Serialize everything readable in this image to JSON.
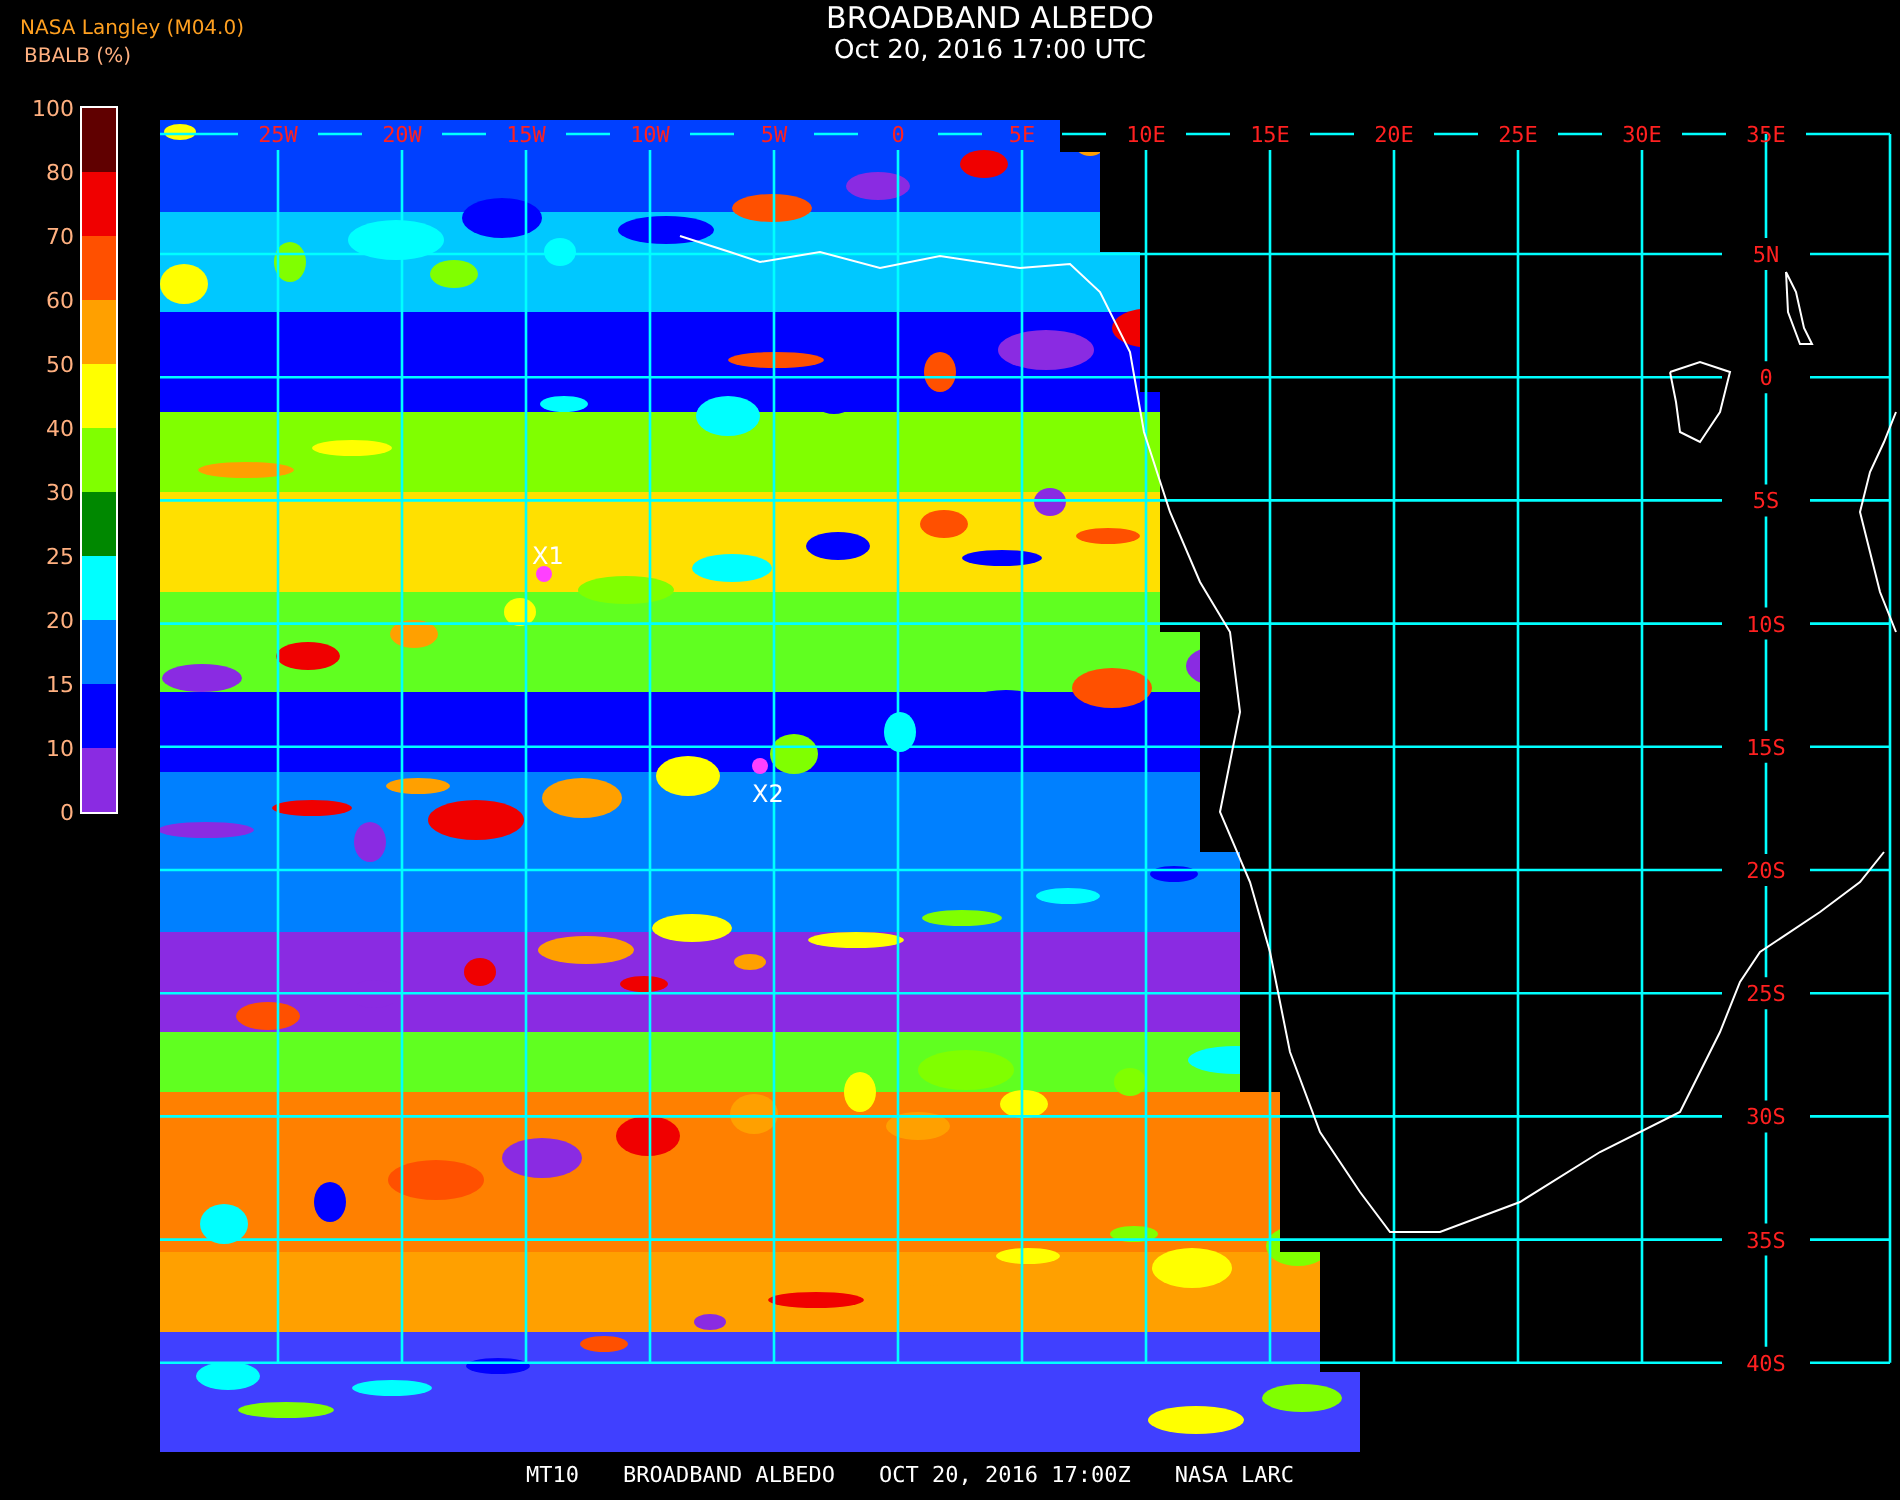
{
  "header": {
    "title": "BROADBAND ALBEDO",
    "datetime": "Oct 20, 2016 17:00 UTC"
  },
  "legend": {
    "source": "NASA Langley (M04.0)",
    "unit": "BBALB (%)",
    "segments": [
      {
        "label": "100",
        "color": "#600000"
      },
      {
        "label": "80",
        "color": "#f00000"
      },
      {
        "label": "70",
        "color": "#ff5000"
      },
      {
        "label": "60",
        "color": "#ffa000"
      },
      {
        "label": "50",
        "color": "#ffff00"
      },
      {
        "label": "40",
        "color": "#80ff00"
      },
      {
        "label": "30",
        "color": "#008800"
      },
      {
        "label": "25",
        "color": "#00ffff"
      },
      {
        "label": "20",
        "color": "#0080ff"
      },
      {
        "label": "15",
        "color": "#0000ff"
      },
      {
        "label": "10",
        "color": "#8a2be2"
      }
    ],
    "bottom_label": "0"
  },
  "map": {
    "longitude_labels": [
      "25W",
      "20W",
      "15W",
      "10W",
      "5W",
      "0",
      "5E",
      "10E",
      "15E",
      "20E",
      "25E",
      "30E",
      "35E"
    ],
    "latitude_labels": [
      "5N",
      "0",
      "5S",
      "10S",
      "15S",
      "20S",
      "25S",
      "30S",
      "35S",
      "40S"
    ],
    "markers": [
      {
        "label": "X1"
      },
      {
        "label": "X2"
      }
    ]
  },
  "footer": [
    "MT10",
    "BROADBAND ALBEDO",
    "OCT 20, 2016 17:00Z",
    "NASA LARC"
  ]
}
